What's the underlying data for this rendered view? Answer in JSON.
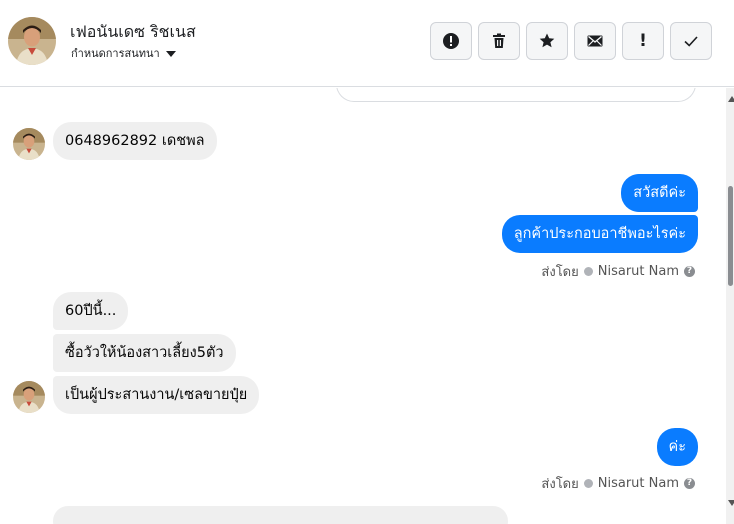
{
  "header": {
    "name": "เฟอนันเดซ ริชเนส",
    "subtitle": "กำหนดการสนทนา",
    "actions": [
      {
        "name": "report-icon",
        "glyph": "!"
      },
      {
        "name": "trash-icon"
      },
      {
        "name": "star-icon"
      },
      {
        "name": "mail-icon"
      },
      {
        "name": "important-icon",
        "glyph": "!"
      },
      {
        "name": "check-icon"
      }
    ]
  },
  "messages": {
    "m1": "0648962892 เดชพล",
    "m2": "สวัสดีค่ะ",
    "m3": "ลูกค้าประกอบอาชีพอะไรค่ะ",
    "m4": "60ปีนี้...",
    "m5": "ซื้อวัวให้น้องสาวเลี้ยง5ตัว",
    "m6": "เป็นผู้ประสานงาน/เซลขายปุ๋ย",
    "m7": "ค่ะ"
  },
  "sent_by": {
    "label": "ส่งโดย",
    "agent": "Nisarut Nam"
  },
  "colors": {
    "outgoing": "#0a7cff",
    "incoming": "#efefef"
  }
}
